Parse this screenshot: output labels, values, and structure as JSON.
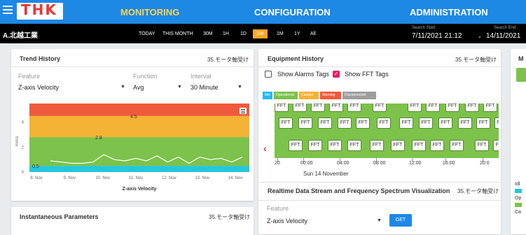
{
  "header": {
    "logo": "THK",
    "nav": [
      {
        "label": "MONITORING",
        "active": true
      },
      {
        "label": "CONFIGURATION",
        "active": false
      },
      {
        "label": "ADMINISTRATION",
        "active": false
      }
    ]
  },
  "subbar": {
    "company": "A.北越工業",
    "ranges": [
      "TODAY",
      "THIS MONTH",
      "30M",
      "1H",
      "1D",
      "1W",
      "1M",
      "1Y",
      "All"
    ],
    "active_range": "1W",
    "search_start_label": "Search Start",
    "search_start_value": "7/11/2021 21:12",
    "search_end_label": "Search End",
    "search_end_value": "14/11/2021"
  },
  "trend": {
    "title": "Trend History",
    "tag": "35.モータ軸受け",
    "feature_label": "Feature",
    "feature_value": "Z-axis Velocity",
    "function_label": "Function",
    "function_value": "Avg",
    "interval_label": "Interval",
    "interval_value": "30 Minute",
    "menu_icon": "hamburger-icon"
  },
  "chart_data": {
    "type": "line",
    "title": "",
    "xlabel": "Z-axis Velocity",
    "ylabel": "mm/s",
    "categories": [
      "8. Nov",
      "9. Nov",
      "10. Nov",
      "11. Nov",
      "12. Nov",
      "13. Nov",
      "14. Nov"
    ],
    "yticks": [
      0,
      2,
      4
    ],
    "ylim": [
      0,
      5.5
    ],
    "bands": [
      {
        "from": 0,
        "to": 0.5,
        "color": "#26c6da"
      },
      {
        "from": 0.5,
        "to": 2.8,
        "color": "#7cc24b"
      },
      {
        "from": 2.8,
        "to": 4.5,
        "color": "#f5b335"
      },
      {
        "from": 4.5,
        "to": 5.5,
        "color": "#f05a3c"
      }
    ],
    "band_labels": [
      "4.5",
      "2.8",
      "0.5"
    ],
    "series": [
      {
        "values": [
          0.9,
          0.8,
          0.7,
          0.7,
          0.8,
          1.4,
          1.0,
          0.9,
          1.1,
          0.9,
          1.3,
          0.8,
          1.2,
          0.7,
          1.2,
          1.0,
          1.1,
          0.8,
          1.2
        ]
      }
    ]
  },
  "equipment": {
    "title": "Equipment History",
    "tag": "35.モータ軸受け",
    "show_alarms_label": "Show Alarms Tags",
    "show_fft_label": "Show FFT Tags",
    "legend": [
      {
        "label": "Idle",
        "color": "#29b6f6"
      },
      {
        "label": "Operational",
        "color": "#7cc24b"
      },
      {
        "label": "Caution",
        "color": "#f5b335"
      },
      {
        "label": "Warning",
        "color": "#f05a3c"
      },
      {
        "label": "Disconnected",
        "color": "#9e9e9e"
      }
    ],
    "fft_label": "FFT",
    "timeline_ticks": [
      "20",
      "00:00",
      "04:00",
      "08:00",
      "12:00",
      "16:00",
      "20:0"
    ],
    "date_label": "Sun 14 November",
    "back_icon": "chevron-left-icon"
  },
  "realtime": {
    "title": "Realtime Data Stream and Frequency Spectrum Visualization",
    "tag": "35.モータ軸受け",
    "feature_label": "Feature",
    "feature_value": "Z-axis Velocity",
    "get_label": "GET"
  },
  "instant": {
    "title": "Instantaneous Parameters",
    "tag": "35.モータ軸受け"
  },
  "partial": {
    "letter": "M",
    "legend": [
      "Idl",
      "Op",
      "Ca"
    ]
  },
  "colors": {
    "header_bg": "#1e88e5",
    "active_nav": "#ffd54f",
    "active_range": "#ffa726",
    "fft_bg": "#7cc24b"
  }
}
